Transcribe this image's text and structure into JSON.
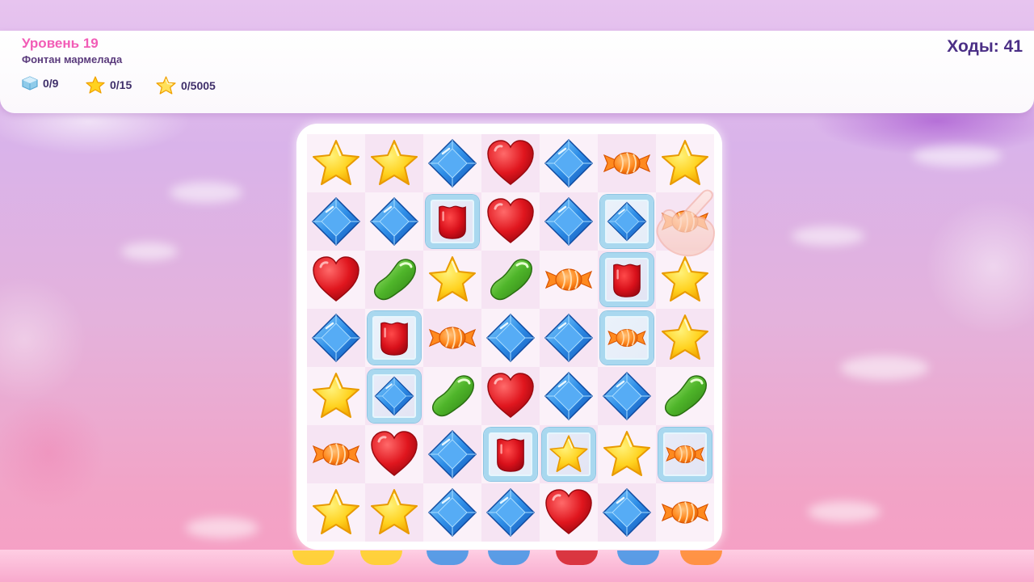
{
  "level": {
    "title": "Уровень 19",
    "subtitle": "Фонтан мармелада"
  },
  "goals": [
    {
      "icon": "ice-cube-icon",
      "value": "0/9"
    },
    {
      "icon": "star-icon",
      "value": "0/15"
    },
    {
      "icon": "score-star-icon",
      "value": "0/5005"
    }
  ],
  "moves": "Ходы: 41",
  "colors": {
    "title_pink": "#f25cb6",
    "moves_purple": "#4b2f86",
    "ice_blue": "#a9d8ef"
  },
  "board": {
    "rows": 7,
    "cols": 7,
    "grid": [
      [
        "star",
        "star",
        "gem",
        "heart",
        "gem",
        "candy",
        "star"
      ],
      [
        "gem",
        "gem",
        "jelly",
        "heart",
        "gem",
        "gem",
        "candy"
      ],
      [
        "heart",
        "bean",
        "star",
        "bean",
        "candy",
        "jelly",
        "star"
      ],
      [
        "gem",
        "jelly",
        "candy",
        "gem",
        "gem",
        "candy",
        "star"
      ],
      [
        "star",
        "gem",
        "bean",
        "heart",
        "gem",
        "gem",
        "bean"
      ],
      [
        "candy",
        "heart",
        "gem",
        "jelly",
        "star",
        "star",
        "candy"
      ],
      [
        "star",
        "star",
        "gem",
        "gem",
        "heart",
        "gem",
        "candy"
      ]
    ],
    "ice": [
      [
        false,
        false,
        false,
        false,
        false,
        false,
        false
      ],
      [
        false,
        false,
        true,
        false,
        false,
        true,
        false
      ],
      [
        false,
        false,
        false,
        false,
        false,
        true,
        false
      ],
      [
        false,
        true,
        false,
        false,
        false,
        true,
        false
      ],
      [
        false,
        true,
        false,
        false,
        false,
        false,
        false
      ],
      [
        false,
        false,
        false,
        true,
        true,
        false,
        true
      ],
      [
        false,
        false,
        false,
        false,
        false,
        false,
        false
      ]
    ],
    "hint": {
      "row": 1,
      "col": 6,
      "icon": "pointing-hand-icon"
    }
  }
}
